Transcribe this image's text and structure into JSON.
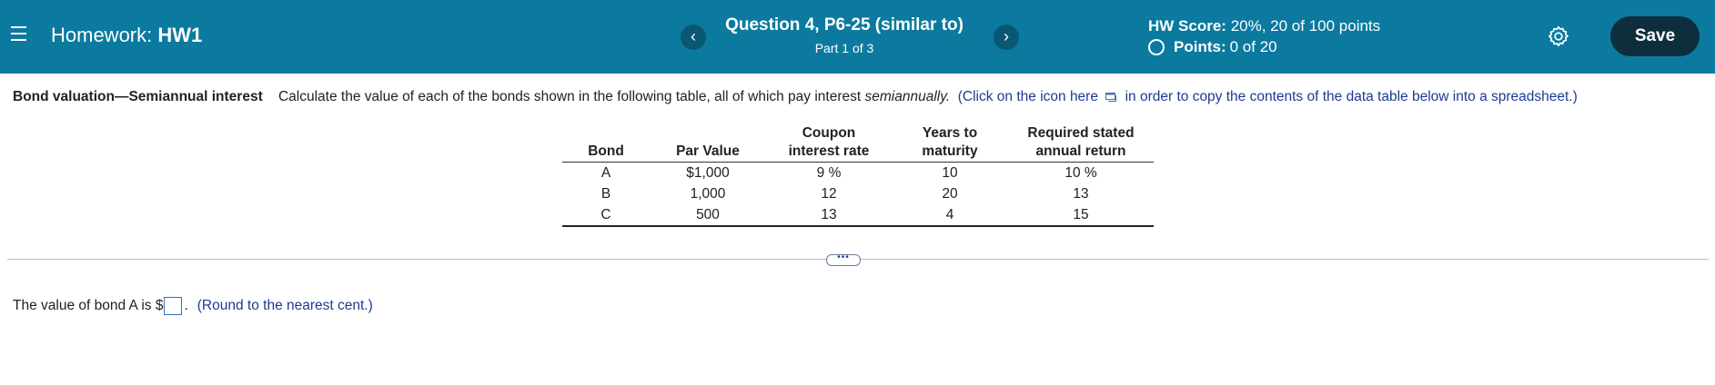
{
  "header": {
    "menu_icon": "hamburger-icon",
    "hw_prefix": "Homework:",
    "hw_name": "HW1",
    "prev_label": "‹",
    "next_label": "›",
    "question_title": "Question 4, P6-25 (similar to)",
    "question_part": "Part 1 of 3",
    "score_label": "HW Score:",
    "score_value": "20%, 20 of 100 points",
    "points_label": "Points:",
    "points_value": "0 of 20",
    "settings_icon": "gear-icon",
    "save_label": "Save",
    "bar_color": "#0b7a9e"
  },
  "prompt": {
    "bold_title": "Bond valuation—Semiannual interest",
    "text_before_italic": "Calculate the value of each of the bonds shown in the following table, all of which pay interest",
    "italic": "semiannually.",
    "link_before_icon": "(Click on the icon here",
    "link_after_icon": "in order to copy the contents of the data table below into a spreadsheet.)",
    "copy_icon": "copy-table-icon"
  },
  "table": {
    "headers": [
      "Bond",
      "Par Value",
      "Coupon interest rate",
      "Years to maturity",
      "Required stated annual return"
    ],
    "header_lines": [
      [
        "Bond"
      ],
      [
        "Par Value"
      ],
      [
        "Coupon",
        "interest rate"
      ],
      [
        "Years to",
        "maturity"
      ],
      [
        "Required stated",
        "annual return"
      ]
    ],
    "rows": [
      [
        "A",
        "$1,000",
        "9 %",
        "10",
        "10 %"
      ],
      [
        "B",
        "1,000",
        "12",
        "20",
        "13"
      ],
      [
        "C",
        "500",
        "13",
        "4",
        "15"
      ]
    ]
  },
  "expand_label": "•••",
  "answer": {
    "before": "The value of bond A is $",
    "after": ".",
    "input_value": "",
    "hint": "(Round to the nearest cent.)"
  }
}
